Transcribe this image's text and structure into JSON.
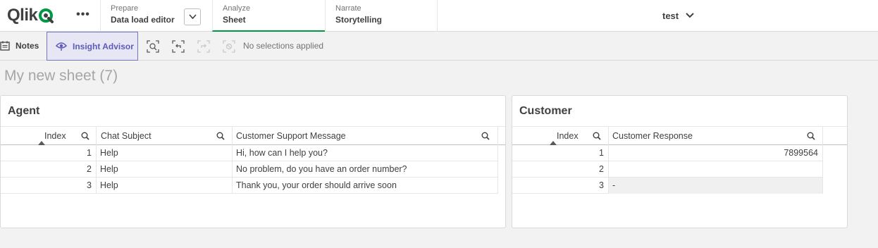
{
  "topbar": {
    "logo_text": "Qlik",
    "more_label": "•••",
    "tabs": [
      {
        "sub": "Prepare",
        "main": "Data load editor"
      },
      {
        "sub": "Analyze",
        "main": "Sheet"
      },
      {
        "sub": "Narrate",
        "main": "Storytelling"
      }
    ],
    "app_title": "test"
  },
  "toolbar": {
    "notes_label": "Notes",
    "insight_label": "Insight Advisor",
    "no_selections": "No selections applied"
  },
  "sheet": {
    "title": "My new sheet (7)"
  },
  "agent_table": {
    "title": "Agent",
    "columns": [
      "Index",
      "Chat Subject",
      "Customer Support Message"
    ],
    "rows": [
      {
        "index": "1",
        "subject": "Help",
        "message": "Hi, how can I help you?"
      },
      {
        "index": "2",
        "subject": "Help",
        "message": "No problem, do you have an order number?"
      },
      {
        "index": "3",
        "subject": "Help",
        "message": "Thank you, your order should arrive soon"
      }
    ]
  },
  "customer_table": {
    "title": "Customer",
    "columns": [
      "Index",
      "Customer Response"
    ],
    "rows": [
      {
        "index": "1",
        "response": "7899564"
      },
      {
        "index": "2",
        "response": ""
      },
      {
        "index": "3",
        "response": "-"
      }
    ]
  },
  "colors": {
    "accent_green": "#009845",
    "insight_purple": "#5c5cb8",
    "insight_bg": "#e6e6f5"
  }
}
